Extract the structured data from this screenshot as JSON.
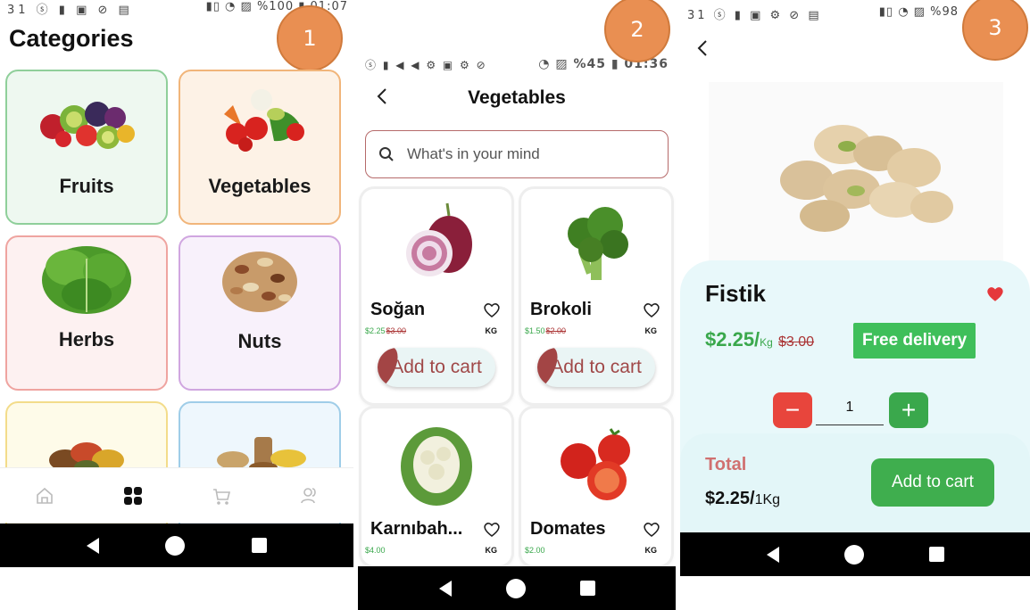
{
  "screen1": {
    "status_left": "31 ⓢ ▮ ▣ ⊘ ▤",
    "status_right": "▮▯ ◔ ▨ %100 ▮ 01:07",
    "badge": "1",
    "title": "Categories",
    "categories": [
      {
        "label": "Fruits",
        "border": "#8fcf9a",
        "bg": "#eef8f0"
      },
      {
        "label": "Vegetables",
        "border": "#f1b57a",
        "bg": "#fdf2e6"
      },
      {
        "label": "Herbs",
        "border": "#efa4a0",
        "bg": "#fdf1f1"
      },
      {
        "label": "Nuts",
        "border": "#d0a6e0",
        "bg": "#f8f1fb"
      },
      {
        "label": "",
        "border": "#f3dc8a",
        "bg": "#fefbe9"
      },
      {
        "label": "",
        "border": "#9fcde8",
        "bg": "#eef7fd"
      }
    ],
    "nav": [
      "home-icon",
      "grid-icon",
      "cart-icon",
      "users-icon"
    ]
  },
  "screen2": {
    "status_left": "ⓢ ▮ ◀ ◀ ⚙ ▣ ⚙ ⊘",
    "status_right": "◔ ▨ %45 ▮ 01:36",
    "badge": "2",
    "title": "Vegetables",
    "search_placeholder": "What's in your mind",
    "products": [
      {
        "name": "Soğan",
        "price": "$2.25",
        "old_price": "$3.00",
        "unit": "KG",
        "cta": "Add to cart"
      },
      {
        "name": "Brokoli",
        "price": "$1.50",
        "old_price": "$2.00",
        "unit": "KG",
        "cta": "Add to cart"
      },
      {
        "name": "Karnıbah...",
        "price": "$4.00",
        "unit": "KG"
      },
      {
        "name": "Domates",
        "price": "$2.00",
        "unit": "KG"
      }
    ]
  },
  "screen3": {
    "status_left": "31 ⓢ ▮ ▣ ⚙ ⊘ ▤",
    "status_right": "▮▯ ◔ ▨ %98",
    "badge": "3",
    "product_name": "Fistik",
    "price": "$2.25/",
    "price_unit": "Kg",
    "old_price": "$3.00",
    "free_delivery": "Free delivery",
    "quantity": "1",
    "total_label": "Total",
    "total_value": "$2.25/",
    "total_unit": "1Kg",
    "cta": "Add to cart",
    "colors": {
      "green": "#3aa84c",
      "red": "#e8453c",
      "panel": "#e8f8fa"
    }
  }
}
